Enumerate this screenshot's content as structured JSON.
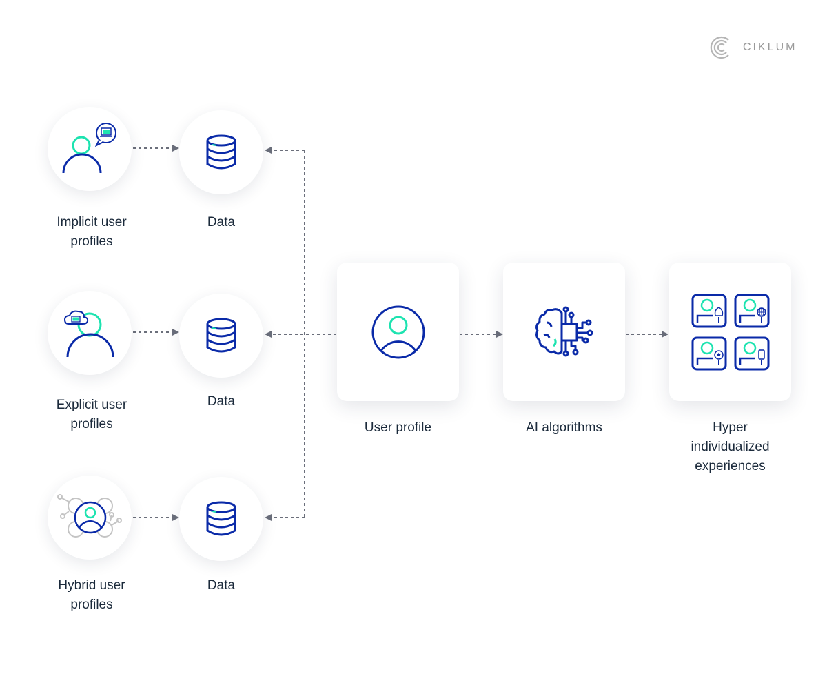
{
  "brand": {
    "name": "CIKLUM",
    "icon": "ciklum-logo-icon"
  },
  "colors": {
    "navy": "#0a2aa8",
    "mint": "#1de3b0",
    "gray_icon": "#bdbdbd",
    "arrow": "#6b6f7b",
    "text": "#1b2a3b"
  },
  "sources": [
    {
      "label_line1": "Implicit user",
      "label_line2": "profiles",
      "icon": "implicit-user-profile-icon",
      "data_label": "Data"
    },
    {
      "label_line1": "Explicit user",
      "label_line2": "profiles",
      "icon": "explicit-user-profile-icon",
      "data_label": "Data"
    },
    {
      "label_line1": "Hybrid user",
      "label_line2": "profiles",
      "icon": "hybrid-user-profile-icon",
      "data_label": "Data"
    }
  ],
  "pipeline": [
    {
      "label_line1": "User profile",
      "icon": "user-profile-icon"
    },
    {
      "label_line1": "AI algorithms",
      "icon": "ai-brain-chip-icon"
    },
    {
      "label_line1": "Hyper",
      "label_line2": "individualized",
      "label_line3": "experiences",
      "icon": "personalized-experiences-icon"
    }
  ]
}
